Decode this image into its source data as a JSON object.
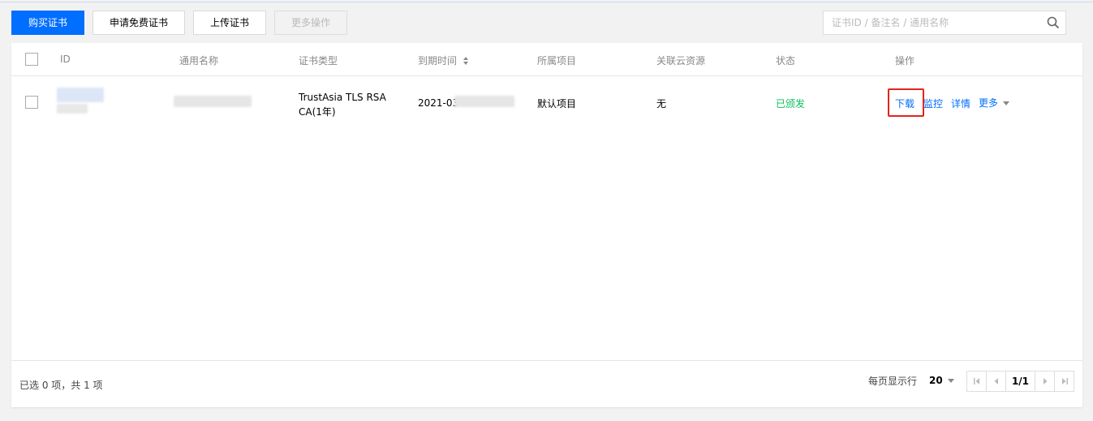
{
  "toolbar": {
    "buy_label": "购买证书",
    "apply_free_label": "申请免费证书",
    "upload_label": "上传证书",
    "more_ops_label": "更多操作"
  },
  "search": {
    "placeholder": "证书ID / 备注名 / 通用名称",
    "icon": "search-icon"
  },
  "table": {
    "columns": [
      "ID",
      "通用名称",
      "证书类型",
      "到期时间",
      "所属项目",
      "关联云资源",
      "状态",
      "操作"
    ],
    "rows": [
      {
        "cert_type_line1": "TrustAsia TLS RSA",
        "cert_type_line2": "CA(1年)",
        "expiry": "2021-03",
        "project": "默认项目",
        "cloud_resource": "无",
        "status": "已颁发",
        "actions": {
          "download": "下载",
          "monitor": "监控",
          "detail": "详情",
          "more": "更多"
        }
      }
    ]
  },
  "footer": {
    "selection": "已选 0 项，共 1 项",
    "per_page_label": "每页显示行",
    "per_page_value": "20",
    "page": "1/1"
  },
  "colors": {
    "primary": "#006eff",
    "success": "#0abf5b",
    "highlight": "#e1251b"
  }
}
